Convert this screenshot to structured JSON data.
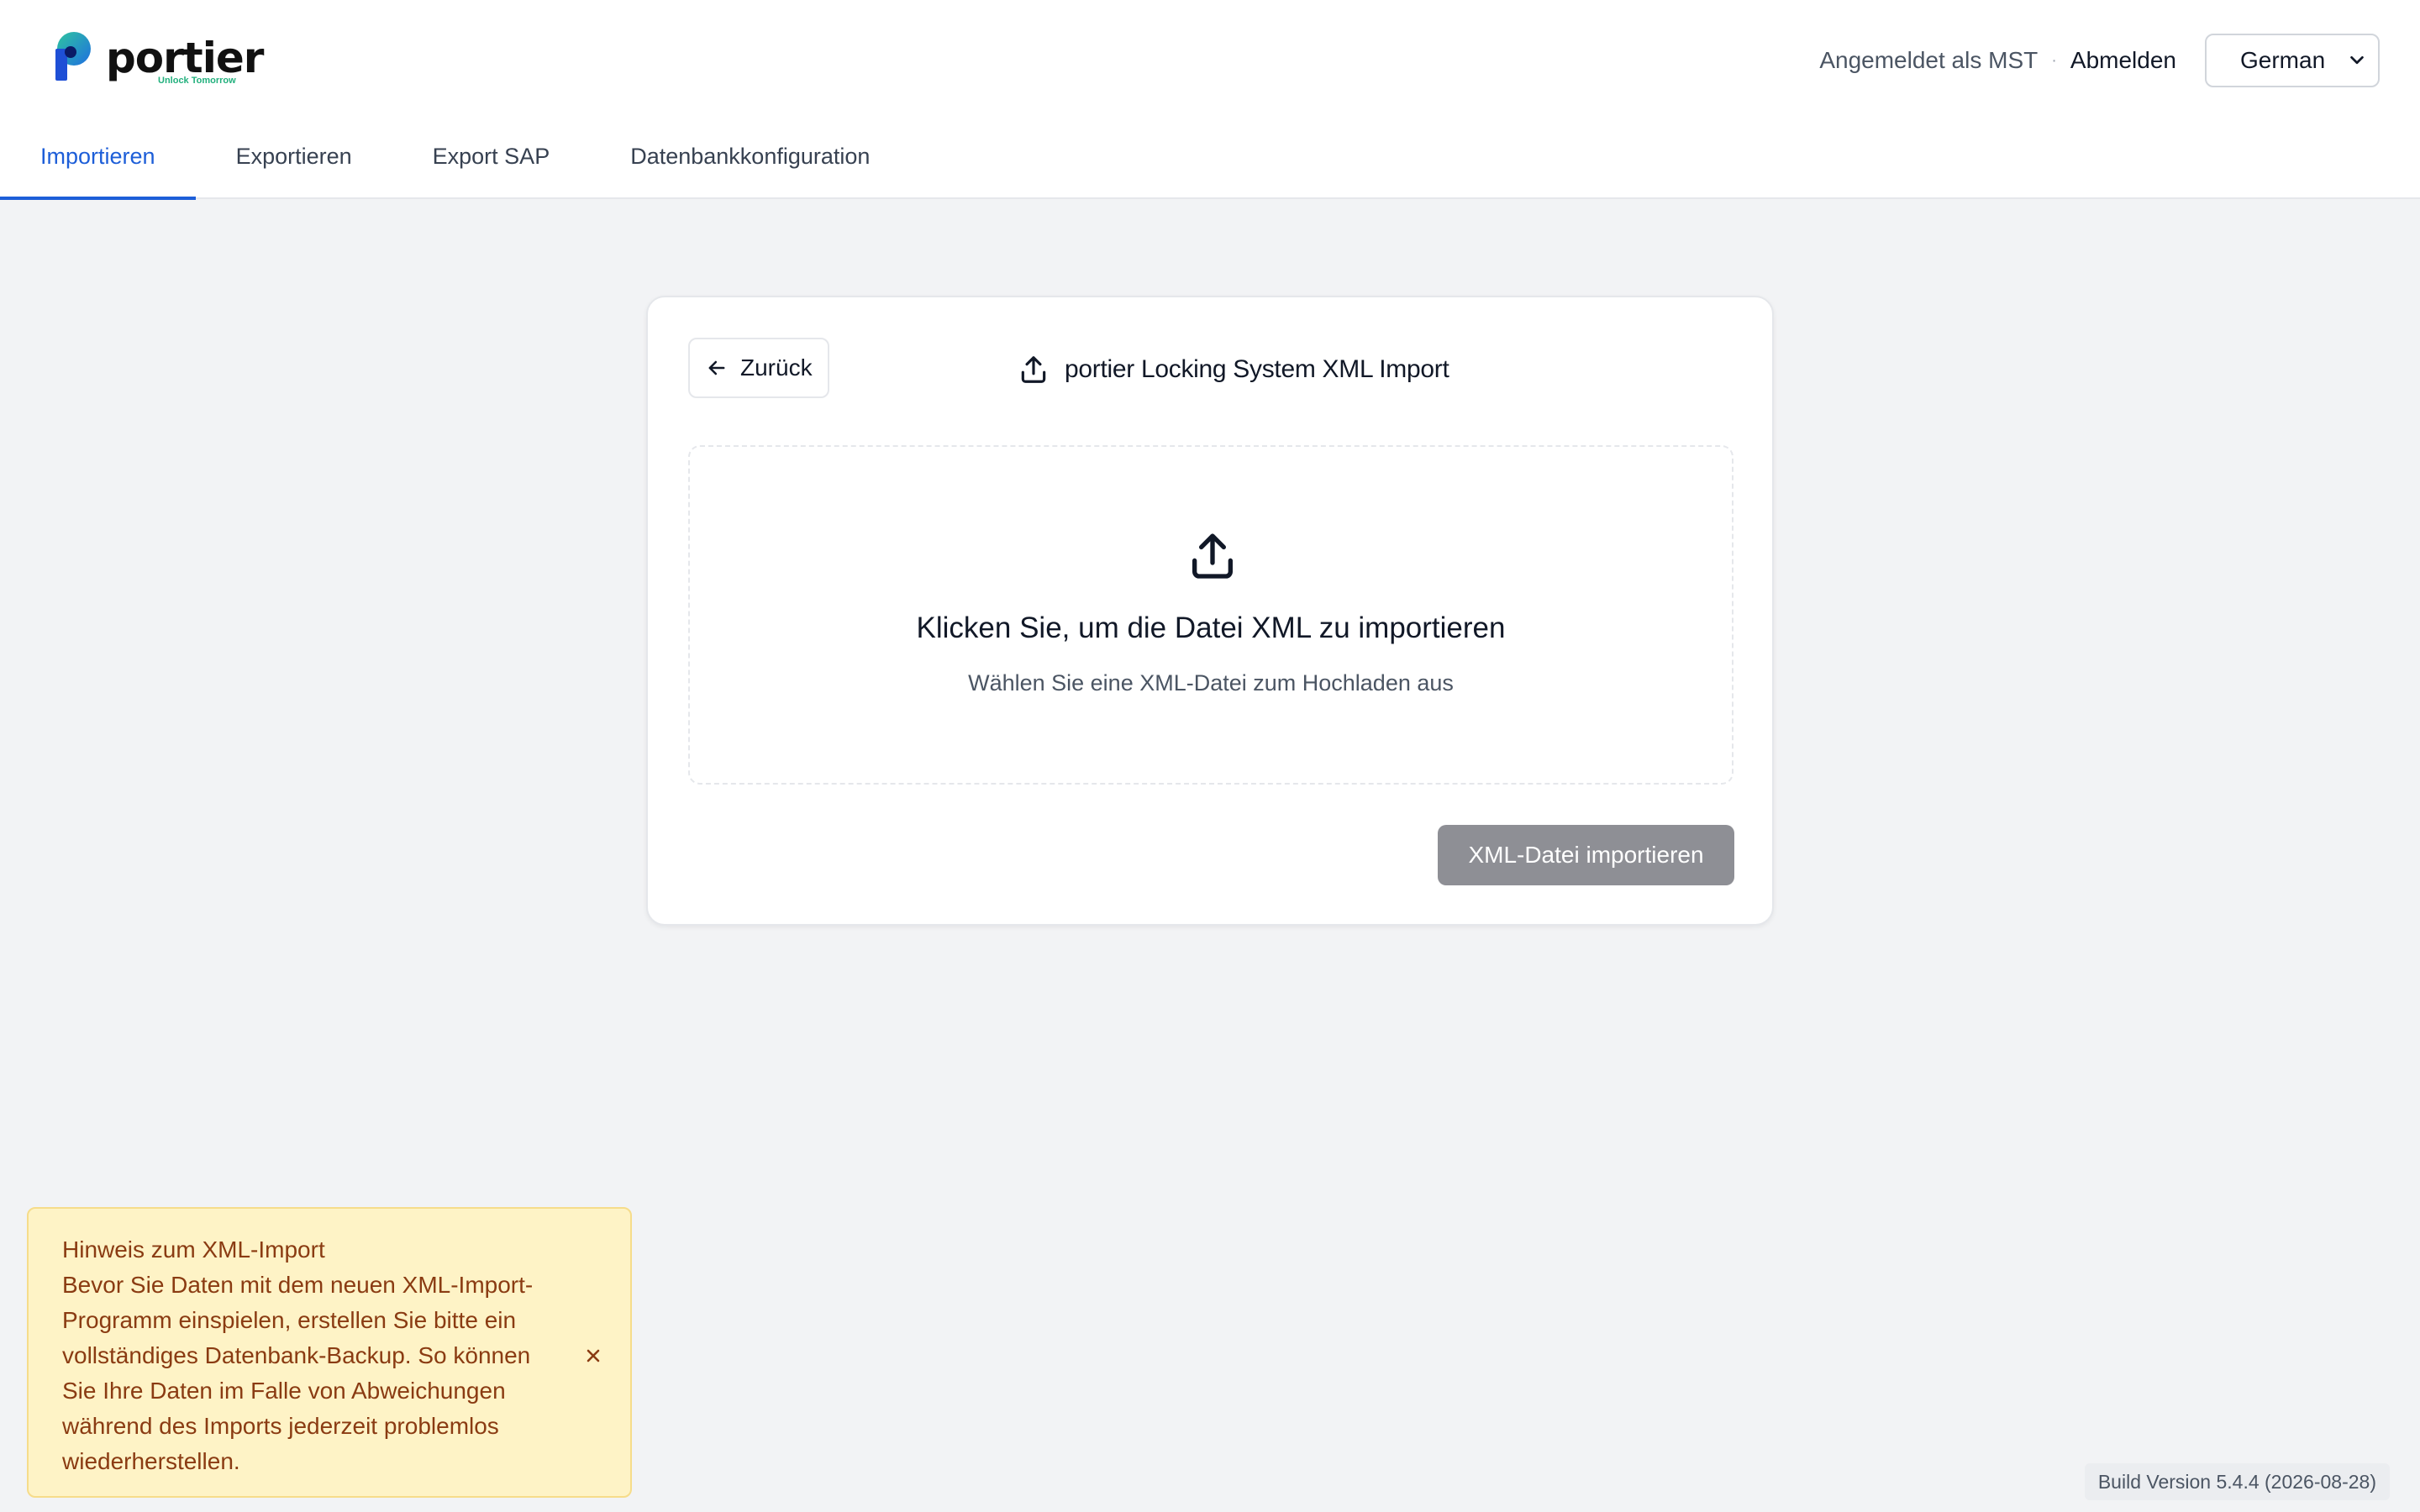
{
  "header": {
    "logo_text": "portier",
    "logo_tagline": "Unlock Tomorrow",
    "signed_in_text": "Angemeldet als MST",
    "separator": "·",
    "logout_label": "Abmelden",
    "language_selected": "German"
  },
  "tabs": [
    {
      "label": "Importieren",
      "active": true
    },
    {
      "label": "Exportieren",
      "active": false
    },
    {
      "label": "Export SAP",
      "active": false
    },
    {
      "label": "Datenbankkonfiguration",
      "active": false
    }
  ],
  "card": {
    "back_label": "Zurück",
    "title": "portier Locking System XML Import",
    "dropzone_title": "Klicken Sie, um die Datei XML zu importieren",
    "dropzone_subtitle": "Wählen Sie eine XML-Datei zum Hochladen aus",
    "import_button_label": "XML-Datei importieren",
    "import_button_enabled": false
  },
  "notice": {
    "title": "Hinweis zum XML-Import",
    "body": "Bevor Sie Daten mit dem neuen XML-Import-Programm einspielen, erstellen Sie bitte ein vollständiges Datenbank-Backup. So können Sie Ihre Daten im Falle von Abweichungen während des Imports jederzeit problemlos wiederherstellen."
  },
  "build_version": "Build Version 5.4.4 (2026-08-28)",
  "colors": {
    "accent": "#1d5ed8",
    "background": "#f2f3f5",
    "notice_bg": "#fef3c6",
    "notice_text": "#8a3b12",
    "disabled_button": "#8e8f95"
  },
  "icons": {
    "logo": "portier-logo-icon",
    "back": "arrow-left-icon",
    "title": "upload-icon",
    "dropzone": "upload-icon",
    "close": "close-icon",
    "select": "chevron-down-icon"
  }
}
